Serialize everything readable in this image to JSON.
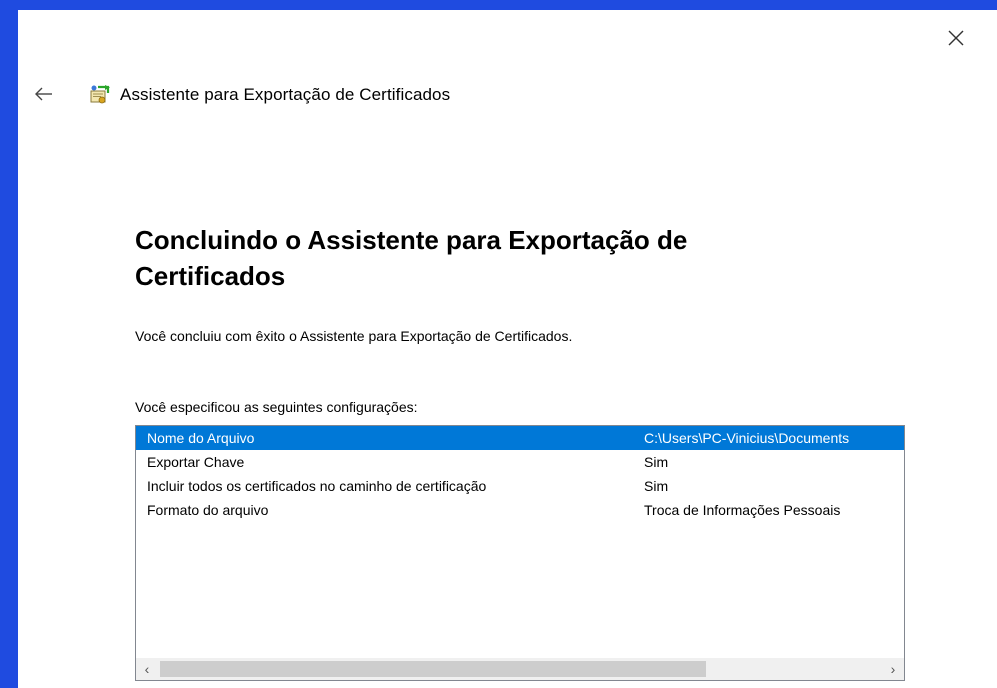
{
  "window": {
    "title": "Assistente para Exportação de Certificados"
  },
  "icons": {
    "close": "close-icon",
    "back": "arrow-left-icon",
    "wizard": "certificate-wizard-icon",
    "scroll_left": "chevron-left-icon",
    "scroll_right": "chevron-right-icon"
  },
  "page": {
    "heading": "Concluindo o Assistente para Exportação de Certificados",
    "description": "Você concluiu com êxito o Assistente para Exportação de Certificados.",
    "settings_label": "Você especificou as seguintes configurações:"
  },
  "settings": [
    {
      "name": "Nome do Arquivo",
      "value": "C:\\Users\\PC-Vinicius\\Documents",
      "selected": true
    },
    {
      "name": "Exportar Chave",
      "value": "Sim",
      "selected": false
    },
    {
      "name": "Incluir todos os certificados no caminho de certificação",
      "value": "Sim",
      "selected": false
    },
    {
      "name": "Formato do arquivo",
      "value": "Troca de Informações Pessoais",
      "selected": false
    }
  ],
  "colors": {
    "background": "#1f4be0",
    "selection": "#0078d7"
  }
}
